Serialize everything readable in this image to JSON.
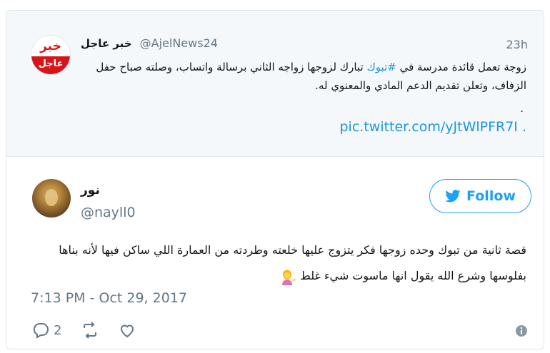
{
  "parent_tweet": {
    "avatar_top": "خبر",
    "avatar_bottom": "عاجل",
    "name": "خبر عاجل",
    "handle": "@AjelNews24",
    "time": "23h",
    "text_before_tag": "زوجة تعمل قائدة مدرسة في ",
    "hashtag": "#تبوك",
    "text_after_tag": " تبارك لزوجها زواجه الثاني برسالة واتساب، وصلته صباح حفل الزفاف، وتعلن تقديم الدعم المادي والمعنوي له.",
    "dot": ".",
    "link": "pic.twitter.com/yJtWlPFR7I ."
  },
  "tweet": {
    "name": "نور",
    "handle": "@nayll0",
    "follow_label": "Follow",
    "text": "قصة ثانية من تبوك وحده زوجها فكر يتزوج عليها خلعته وطردته من العمارة اللي ساكن فيها لأنه بناها بفلوسها وشرع الله يقول انها ماسوت شيء غلط",
    "date": "7:13 PM - Oct 29, 2017",
    "reply_count": "2"
  },
  "colors": {
    "accent": "#1da1f2",
    "link": "#1b95e0",
    "muted": "#657786",
    "brand_red": "#d7141a"
  },
  "icons": {
    "reply": "reply-icon",
    "retweet": "retweet-icon",
    "like": "heart-icon",
    "info": "info-icon",
    "follow": "twitter-bird-icon",
    "emoji": "person-tipping-hand-emoji"
  }
}
